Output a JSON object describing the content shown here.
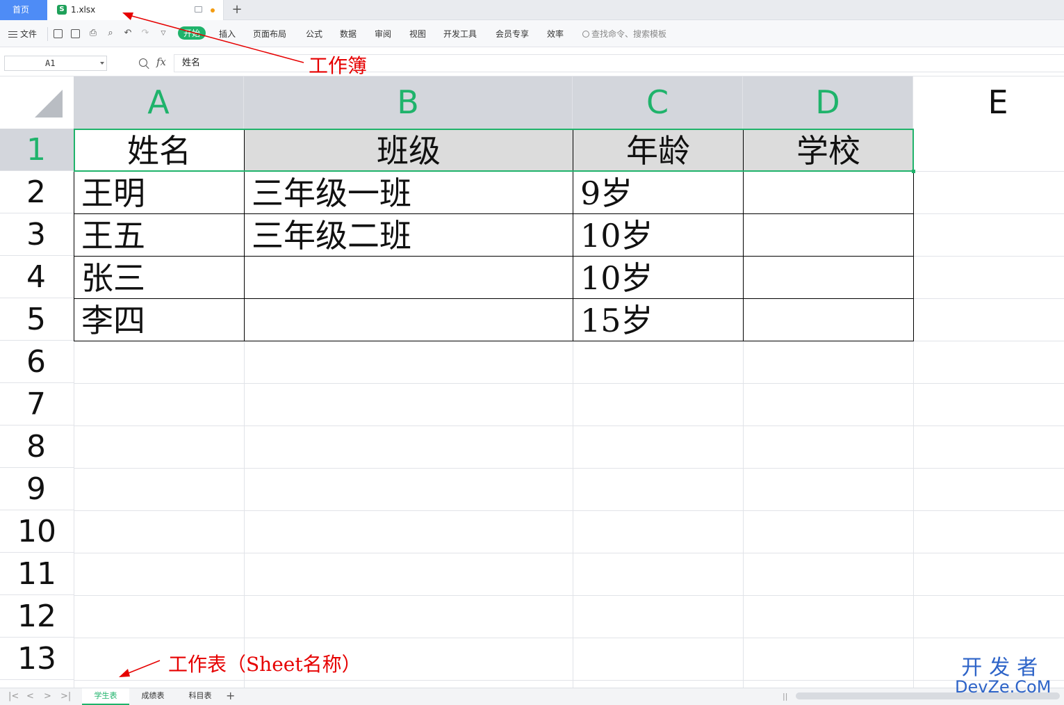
{
  "tabbar": {
    "home_label": "首页",
    "file_icon_glyph": "S",
    "file_name": "1.xlsx",
    "add_label": "+"
  },
  "ribbon": {
    "file_menu_label": "文件",
    "tabs": [
      "开始",
      "插入",
      "页面布局",
      "公式",
      "数据",
      "审阅",
      "视图",
      "开发工具",
      "会员专享",
      "效率"
    ],
    "active_tab": "开始",
    "search_placeholder": "查找命令、搜索模板",
    "icons": [
      "save-icon",
      "export-icon",
      "print-icon",
      "preview-icon",
      "undo-icon",
      "redo-icon",
      "more-icon"
    ]
  },
  "formula_bar": {
    "name_box": "A1",
    "fx_label": "fx",
    "content": "姓名"
  },
  "grid": {
    "columns": [
      "A",
      "B",
      "C",
      "D",
      "E"
    ],
    "selected_columns": [
      "A",
      "B",
      "C",
      "D"
    ],
    "rows": [
      "1",
      "2",
      "3",
      "4",
      "5",
      "6",
      "7",
      "8",
      "9",
      "10",
      "11",
      "12",
      "13"
    ],
    "selected_row": "1",
    "cells": [
      [
        "姓名",
        "班级",
        "年龄",
        "学校"
      ],
      [
        "王明",
        "三年级一班",
        "9岁",
        ""
      ],
      [
        "王五",
        "三年级二班",
        "10岁",
        ""
      ],
      [
        "张三",
        "",
        "10岁",
        ""
      ],
      [
        "李四",
        "",
        "15岁",
        ""
      ]
    ]
  },
  "sheets": {
    "tabs": [
      "学生表",
      "成绩表",
      "科目表"
    ],
    "active": "学生表",
    "add_label": "+",
    "nav": [
      "|<",
      "<",
      ">",
      ">|"
    ]
  },
  "annotations": {
    "workbook_label": "工作簿",
    "sheet_label": "工作表（Sheet名称）"
  },
  "watermark": {
    "line1": "开发者",
    "line2": "DevZe.CoM"
  },
  "colors": {
    "accent": "#1fb36b",
    "home_tab": "#4e8cf6",
    "annotation": "#e60000",
    "watermark": "#2e64c8"
  }
}
